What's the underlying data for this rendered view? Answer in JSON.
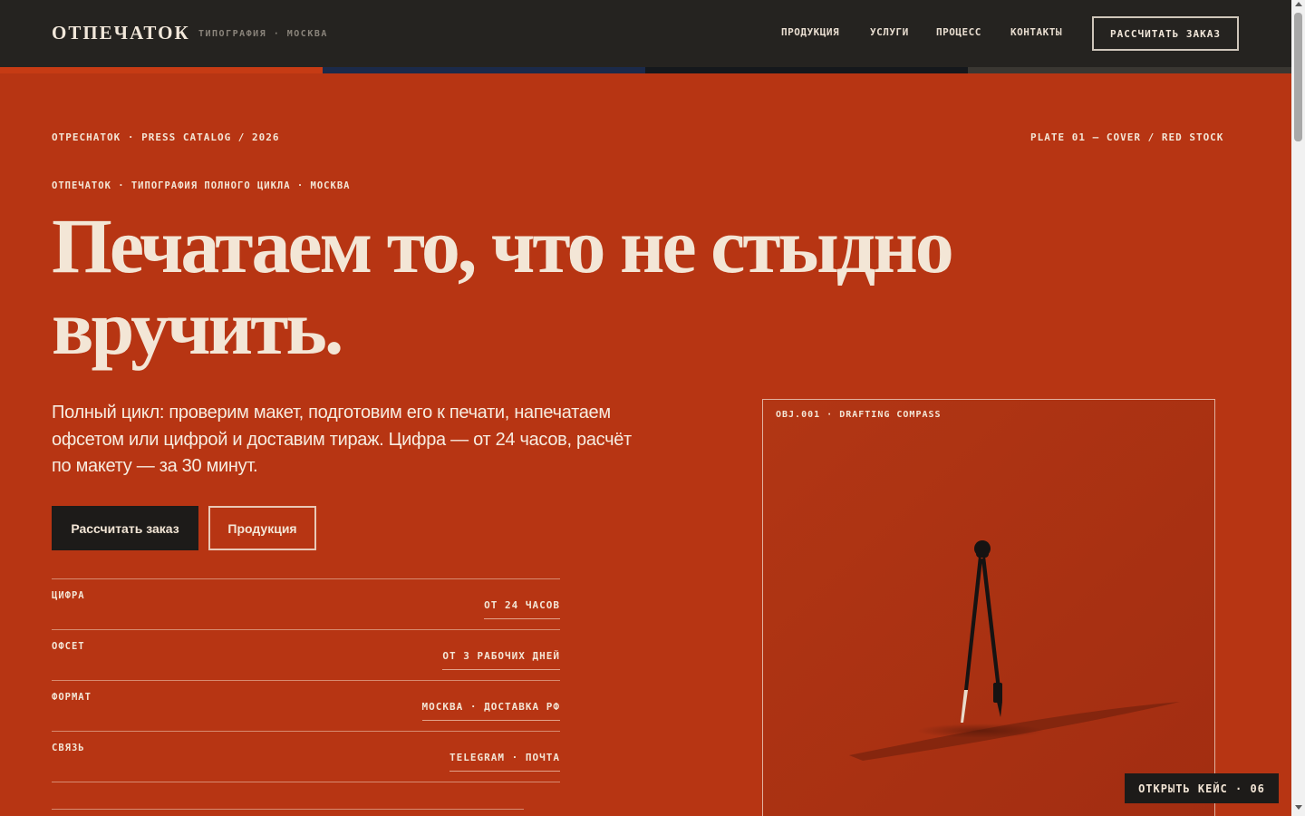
{
  "header": {
    "brand": "ОТПЕЧАТОК",
    "brand_sub": "ТИПОГРАФИЯ · МОСКВА",
    "nav": [
      "ПРОДУКЦИЯ",
      "УСЛУГИ",
      "ПРОЦЕСС",
      "КОНТАКТЫ"
    ],
    "cta": "РАССЧИТАТЬ ЗАКАЗ"
  },
  "progress_colors": [
    "#c63b14",
    "#1b2a4a",
    "#15181c",
    "#3a3732"
  ],
  "hero": {
    "meta_left": "ОТРЕСНАТОК · PRESS CATALOG / 2026",
    "meta_right": "PLATE 01 — COVER / RED STOCK",
    "kicker": "ОТПЕЧАТОК · ТИПОГРАФИЯ ПОЛНОГО ЦИКЛА · МОСКВА",
    "headline_line1": "Печатаем то, что не стыдно",
    "headline_line2": "вручить.",
    "lead": "Полный цикл: проверим макет, подготовим его к печати, напечатаем офсетом или цифрой и доставим тираж. Цифра — от 24 часов, расчёт по макету — за 30 минут.",
    "btn_primary": "Рассчитать заказ",
    "btn_secondary": "Продукция"
  },
  "specs": [
    {
      "label": "ЦИФРА",
      "value": "ОТ 24 ЧАСОВ"
    },
    {
      "label": "ОФСЕТ",
      "value": "ОТ 3 РАБОЧИХ ДНЕЙ"
    },
    {
      "label": "ФОРМАТ",
      "value": "МОСКВА · ДОСТАВКА РФ"
    },
    {
      "label": "СВЯЗЬ",
      "value": "TELEGRAM · ПОЧТА"
    }
  ],
  "plate": {
    "caption": "OBJ.001 · DRAFTING COMPASS",
    "icon": "drafting-compass"
  },
  "case_button": "ОТКРЫТЬ КЕЙС · 06",
  "colors": {
    "background": "#b73513",
    "header": "#252320",
    "ink": "#f3e6d6",
    "dark_button": "#1d1b19"
  }
}
